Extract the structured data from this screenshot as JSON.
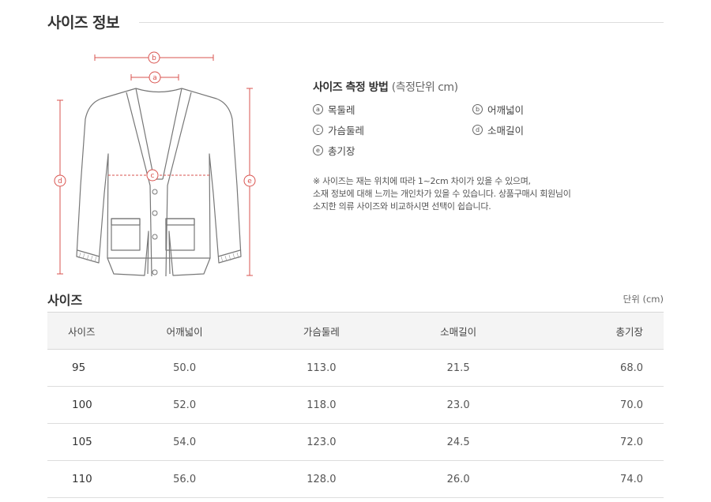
{
  "section_title": "사이즈 정보",
  "diagram": {
    "markers": {
      "a": "a",
      "b": "b",
      "c": "c",
      "d": "d",
      "e": "e"
    }
  },
  "howto": {
    "title": "사이즈 측정 방법",
    "unit": "(측정단위 cm)",
    "legend": [
      {
        "key": "a",
        "label": "목둘레"
      },
      {
        "key": "b",
        "label": "어깨넓이"
      },
      {
        "key": "c",
        "label": "가슴둘레"
      },
      {
        "key": "d",
        "label": "소매길이"
      },
      {
        "key": "e",
        "label": "총기장"
      }
    ],
    "notes": [
      "※ 사이즈는 재는 위치에 따라 1~2cm 차이가 있을 수 있으며,",
      "소재 정보에 대해  느끼는 개인차가 있을 수 있습니다. 상품구매시 회원님이",
      "소지한 의류 사이즈와 비교하시면 선택이 쉽습니다."
    ]
  },
  "size_table": {
    "title": "사이즈",
    "unit": "단위 (cm)",
    "headers": [
      "사이즈",
      "어깨넓이",
      "가슴둘레",
      "소매길이",
      "총기장"
    ],
    "rows": [
      [
        "95",
        "50.0",
        "113.0",
        "21.5",
        "68.0"
      ],
      [
        "100",
        "52.0",
        "118.0",
        "23.0",
        "70.0"
      ],
      [
        "105",
        "54.0",
        "123.0",
        "24.5",
        "72.0"
      ],
      [
        "110",
        "56.0",
        "128.0",
        "26.0",
        "74.0"
      ]
    ]
  },
  "colors": {
    "measure_line": "#d9534f",
    "garment_line": "#777777",
    "header_bg": "#f4f4f4"
  }
}
